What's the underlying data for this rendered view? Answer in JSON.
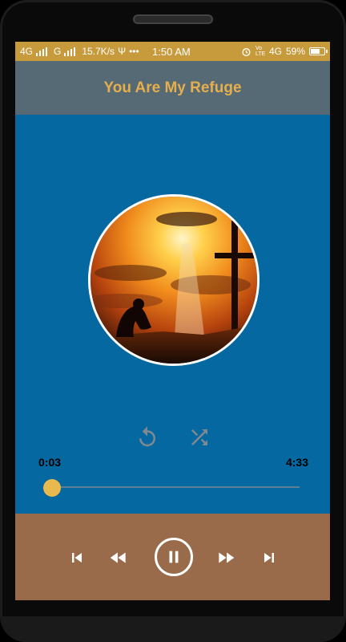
{
  "status_bar": {
    "network_left": "4G",
    "network_right_label": "G",
    "speed": "15.7K/s",
    "time": "1:50 AM",
    "volte": "Vo LTE",
    "network_4g": "4G",
    "battery": "59%"
  },
  "header": {
    "title": "You Are My Refuge"
  },
  "player": {
    "elapsed": "0:03",
    "duration": "4:33",
    "progress": 0.011
  },
  "icons": {
    "repeat": "repeat-icon",
    "shuffle": "shuffle-icon",
    "skip_previous": "skip-previous-icon",
    "rewind": "rewind-icon",
    "pause": "pause-icon",
    "fast_forward": "fast-forward-icon",
    "skip_next": "skip-next-icon"
  },
  "colors": {
    "status_bar": "#c79b3c",
    "app_bar": "#556a74",
    "title": "#e6ae4d",
    "main_bg": "#0668a0",
    "controls_bg": "#9a6b4a",
    "seek_thumb": "#e8b94f"
  }
}
